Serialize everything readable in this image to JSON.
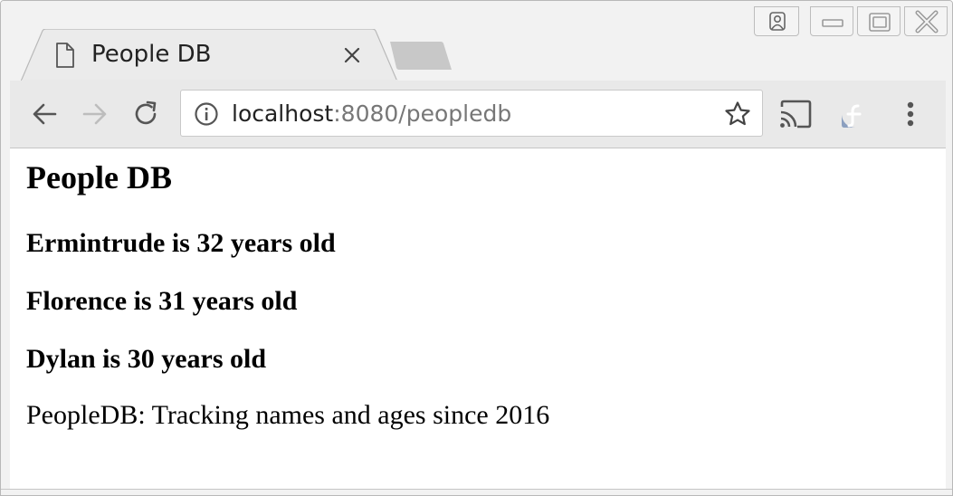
{
  "browser": {
    "tab": {
      "title": "People DB"
    },
    "address_bar": {
      "host": "localhost",
      "path": ":8080/peopledb"
    }
  },
  "page": {
    "heading": "People DB",
    "people": [
      "Ermintrude is 32 years old",
      "Florence is 31 years old",
      "Dylan is 30 years old"
    ],
    "footer": "PeopleDB: Tracking names and ages since 2016"
  },
  "icons": {
    "tab": "document-icon",
    "tab_close": "close-icon",
    "back": "back-arrow-icon",
    "forward": "forward-arrow-icon",
    "reload": "reload-icon",
    "info": "info-icon",
    "bookmark": "star-icon",
    "cast": "cast-icon",
    "extension": "fedora-icon",
    "menu": "kebab-menu-icon",
    "profile": "person-icon",
    "minimize": "minimize-icon",
    "maximize": "maximize-icon",
    "window_close": "window-close-icon"
  },
  "colors": {
    "chrome_background": "#f2f2f2",
    "toolbar_background": "#e9e9e9",
    "url_host": "#222222",
    "url_path": "#777777",
    "fedora_blue": "#8b9fbf"
  }
}
